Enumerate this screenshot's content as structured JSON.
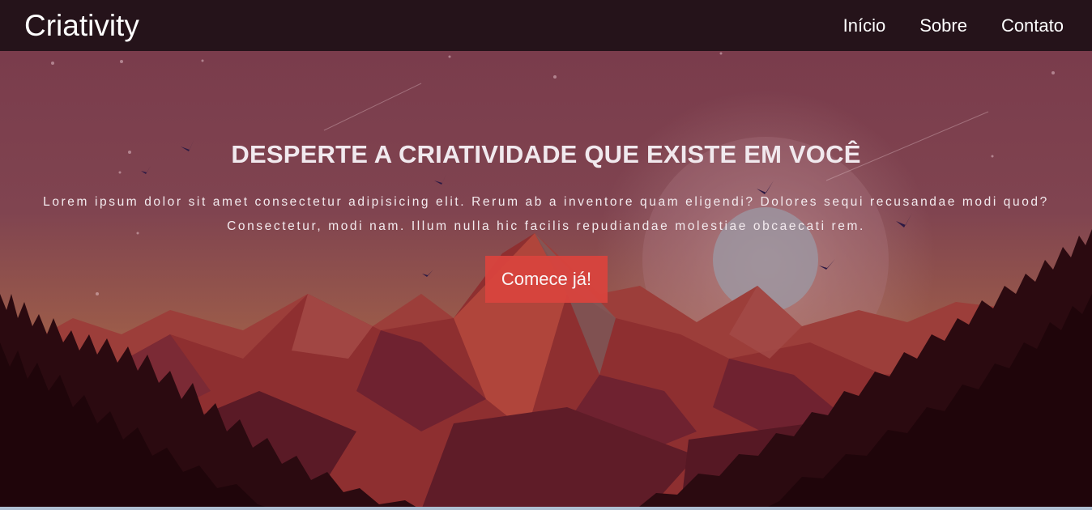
{
  "navbar": {
    "brand": "Criativity",
    "links": [
      {
        "label": "Início"
      },
      {
        "label": "Sobre"
      },
      {
        "label": "Contato"
      }
    ]
  },
  "hero": {
    "title": "DESPERTE A CRIATIVIDADE QUE EXISTE EM VOCÊ",
    "text": "Lorem ipsum dolor sit amet consectetur adipisicing elit. Rerum ab a inventore quam eligendi? Dolores sequi recusandae modi quod? Consectetur, modi nam. Illum nulla hic facilis repudiandae molestiae obcaecati rem.",
    "cta_label": "Comece já!"
  },
  "colors": {
    "navbar_bg": "#25131a",
    "cta_bg": "#d9443e",
    "sky_top": "#7a3c4c",
    "sky_bottom": "#b97050",
    "forest": "#23070c"
  }
}
